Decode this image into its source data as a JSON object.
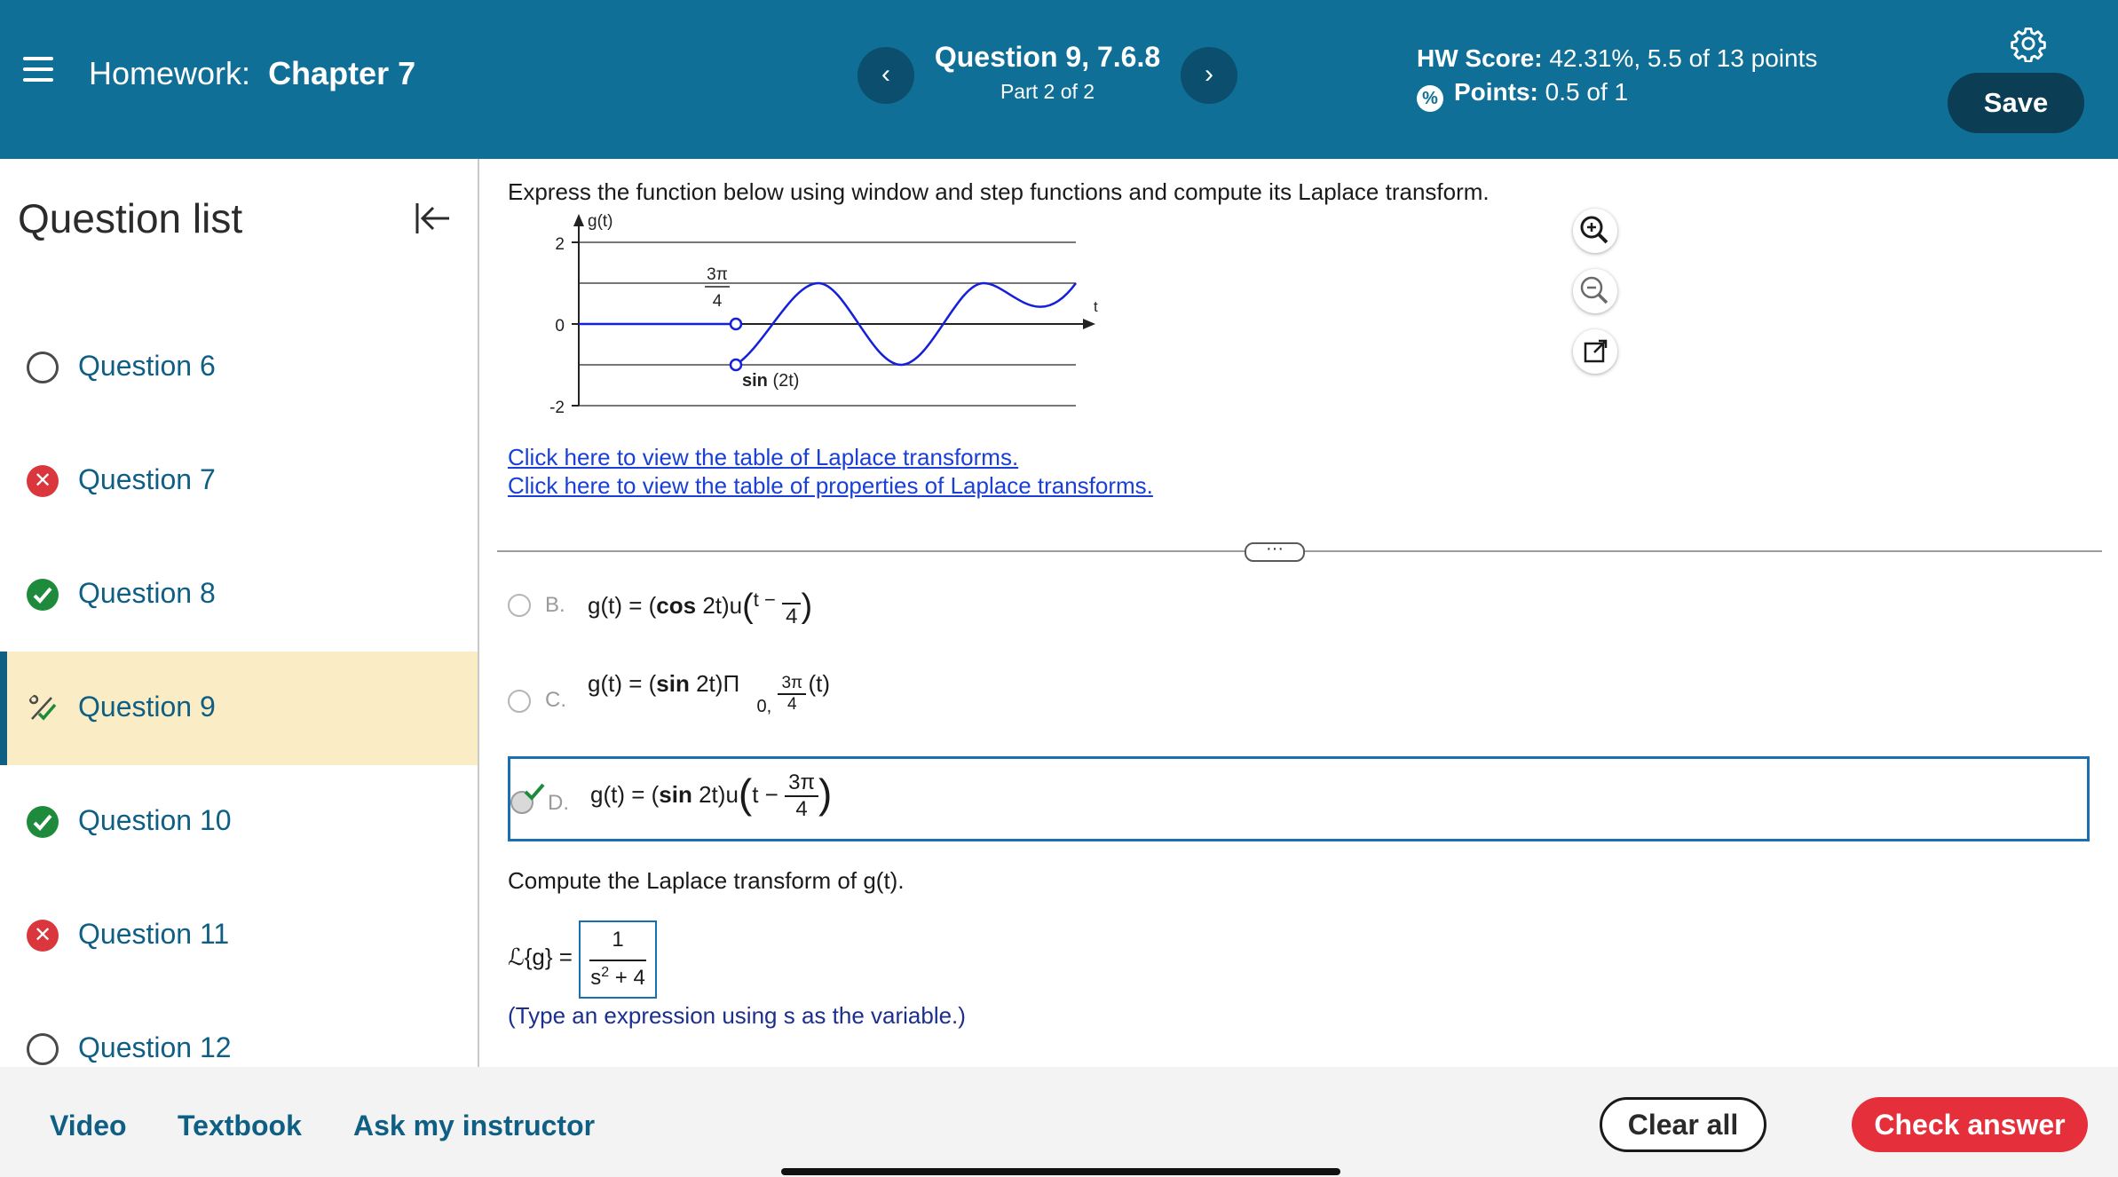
{
  "header": {
    "title_prefix": "Homework:",
    "title_name": "Chapter 7",
    "question_title": "Question 9, 7.6.8",
    "question_part": "Part 2 of 2",
    "hw_score_label": "HW Score:",
    "hw_score_value": "42.31%, 5.5 of 13 points",
    "points_label": "Points:",
    "points_value": "0.5 of 1",
    "save_label": "Save",
    "prev_icon": "chevron-left-icon",
    "next_icon": "chevron-right-icon",
    "settings_icon": "gear-icon",
    "colors": {
      "bar": "#0f6f96",
      "save": "#0b3d55"
    }
  },
  "sidebar": {
    "title": "Question list",
    "items": [
      {
        "label": "Question 6",
        "status": "not-attempted"
      },
      {
        "label": "Question 7",
        "status": "incorrect"
      },
      {
        "label": "Question 8",
        "status": "correct"
      },
      {
        "label": "Question 9",
        "status": "partial",
        "active": true
      },
      {
        "label": "Question 10",
        "status": "correct"
      },
      {
        "label": "Question 11",
        "status": "incorrect"
      },
      {
        "label": "Question 12",
        "status": "not-attempted"
      }
    ]
  },
  "main": {
    "prompt": "Express the function below using window and step functions and compute its Laplace transform.",
    "graph": {
      "y_axis_label": "g(t)",
      "x_axis_label": "t",
      "y_ticks": [
        "2",
        "0",
        "-2"
      ],
      "annot_num": "3π",
      "annot_den": "4",
      "curve_label_bold": "sin",
      "curve_label_rest": " (2t)"
    },
    "links": [
      "Click here to view the table of Laplace transforms.",
      "Click here to view the table of properties of Laplace transforms."
    ],
    "options": {
      "b": {
        "letter": "B.",
        "lhs": "g(t) = (",
        "fn": "cos",
        "mid": " 2t)u",
        "inner": "t −",
        "num": "",
        "den": "4"
      },
      "c": {
        "letter": "C.",
        "lhs": "g(t) = (",
        "fn": "sin",
        "mid": " 2t)Π",
        "sub_prefix": "0,",
        "num": "3π",
        "den": "4",
        "arg": "(t)"
      },
      "d": {
        "letter": "D.",
        "lhs": "g(t) = (",
        "fn": "sin",
        "mid": " 2t)u",
        "inner": "t −",
        "num": "3π",
        "den": "4"
      }
    },
    "compute_prompt": "Compute the Laplace transform of g(t).",
    "answer": {
      "lhs": "ℒ{g} =",
      "num": "1",
      "den_base": "s",
      "den_exp": "2",
      "den_rest": " + 4"
    },
    "hint": "(Type an expression using s as the variable.)"
  },
  "footer": {
    "video": "Video",
    "textbook": "Textbook",
    "ask": "Ask my instructor",
    "clear": "Clear all",
    "check": "Check answer",
    "colors": {
      "check": "#e5303b"
    }
  }
}
